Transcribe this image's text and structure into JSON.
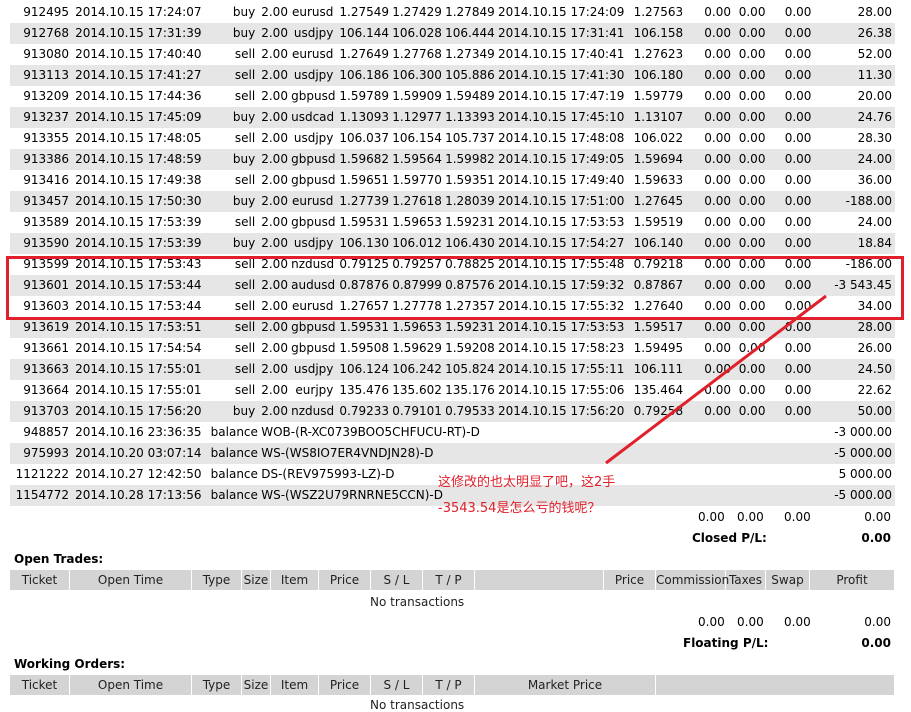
{
  "trades": [
    {
      "ticket": "912495",
      "open_time": "2014.10.15 17:24:07",
      "type": "buy",
      "size": "2.00",
      "item": "eurusd",
      "price": "1.27549",
      "sl": "1.27429",
      "tp": "1.27849",
      "close_time": "2014.10.15 17:24:09",
      "close_price": "1.27563",
      "commission": "0.00",
      "taxes": "0.00",
      "swap": "0.00",
      "profit": "28.00"
    },
    {
      "ticket": "912768",
      "open_time": "2014.10.15 17:31:39",
      "type": "buy",
      "size": "2.00",
      "item": "usdjpy",
      "price": "106.144",
      "sl": "106.028",
      "tp": "106.444",
      "close_time": "2014.10.15 17:31:41",
      "close_price": "106.158",
      "commission": "0.00",
      "taxes": "0.00",
      "swap": "0.00",
      "profit": "26.38"
    },
    {
      "ticket": "913080",
      "open_time": "2014.10.15 17:40:40",
      "type": "sell",
      "size": "2.00",
      "item": "eurusd",
      "price": "1.27649",
      "sl": "1.27768",
      "tp": "1.27349",
      "close_time": "2014.10.15 17:40:41",
      "close_price": "1.27623",
      "commission": "0.00",
      "taxes": "0.00",
      "swap": "0.00",
      "profit": "52.00"
    },
    {
      "ticket": "913113",
      "open_time": "2014.10.15 17:41:27",
      "type": "sell",
      "size": "2.00",
      "item": "usdjpy",
      "price": "106.186",
      "sl": "106.300",
      "tp": "105.886",
      "close_time": "2014.10.15 17:41:30",
      "close_price": "106.180",
      "commission": "0.00",
      "taxes": "0.00",
      "swap": "0.00",
      "profit": "11.30"
    },
    {
      "ticket": "913209",
      "open_time": "2014.10.15 17:44:36",
      "type": "sell",
      "size": "2.00",
      "item": "gbpusd",
      "price": "1.59789",
      "sl": "1.59909",
      "tp": "1.59489",
      "close_time": "2014.10.15 17:47:19",
      "close_price": "1.59779",
      "commission": "0.00",
      "taxes": "0.00",
      "swap": "0.00",
      "profit": "20.00"
    },
    {
      "ticket": "913237",
      "open_time": "2014.10.15 17:45:09",
      "type": "buy",
      "size": "2.00",
      "item": "usdcad",
      "price": "1.13093",
      "sl": "1.12977",
      "tp": "1.13393",
      "close_time": "2014.10.15 17:45:10",
      "close_price": "1.13107",
      "commission": "0.00",
      "taxes": "0.00",
      "swap": "0.00",
      "profit": "24.76"
    },
    {
      "ticket": "913355",
      "open_time": "2014.10.15 17:48:05",
      "type": "sell",
      "size": "2.00",
      "item": "usdjpy",
      "price": "106.037",
      "sl": "106.154",
      "tp": "105.737",
      "close_time": "2014.10.15 17:48:08",
      "close_price": "106.022",
      "commission": "0.00",
      "taxes": "0.00",
      "swap": "0.00",
      "profit": "28.30"
    },
    {
      "ticket": "913386",
      "open_time": "2014.10.15 17:48:59",
      "type": "buy",
      "size": "2.00",
      "item": "gbpusd",
      "price": "1.59682",
      "sl": "1.59564",
      "tp": "1.59982",
      "close_time": "2014.10.15 17:49:05",
      "close_price": "1.59694",
      "commission": "0.00",
      "taxes": "0.00",
      "swap": "0.00",
      "profit": "24.00"
    },
    {
      "ticket": "913416",
      "open_time": "2014.10.15 17:49:38",
      "type": "sell",
      "size": "2.00",
      "item": "gbpusd",
      "price": "1.59651",
      "sl": "1.59770",
      "tp": "1.59351",
      "close_time": "2014.10.15 17:49:40",
      "close_price": "1.59633",
      "commission": "0.00",
      "taxes": "0.00",
      "swap": "0.00",
      "profit": "36.00"
    },
    {
      "ticket": "913457",
      "open_time": "2014.10.15 17:50:30",
      "type": "buy",
      "size": "2.00",
      "item": "eurusd",
      "price": "1.27739",
      "sl": "1.27618",
      "tp": "1.28039",
      "close_time": "2014.10.15 17:51:00",
      "close_price": "1.27645",
      "commission": "0.00",
      "taxes": "0.00",
      "swap": "0.00",
      "profit": "-188.00"
    },
    {
      "ticket": "913589",
      "open_time": "2014.10.15 17:53:39",
      "type": "sell",
      "size": "2.00",
      "item": "gbpusd",
      "price": "1.59531",
      "sl": "1.59653",
      "tp": "1.59231",
      "close_time": "2014.10.15 17:53:53",
      "close_price": "1.59519",
      "commission": "0.00",
      "taxes": "0.00",
      "swap": "0.00",
      "profit": "24.00"
    },
    {
      "ticket": "913590",
      "open_time": "2014.10.15 17:53:39",
      "type": "buy",
      "size": "2.00",
      "item": "usdjpy",
      "price": "106.130",
      "sl": "106.012",
      "tp": "106.430",
      "close_time": "2014.10.15 17:54:27",
      "close_price": "106.140",
      "commission": "0.00",
      "taxes": "0.00",
      "swap": "0.00",
      "profit": "18.84"
    },
    {
      "ticket": "913599",
      "open_time": "2014.10.15 17:53:43",
      "type": "sell",
      "size": "2.00",
      "item": "nzdusd",
      "price": "0.79125",
      "sl": "0.79257",
      "tp": "0.78825",
      "close_time": "2014.10.15 17:55:48",
      "close_price": "0.79218",
      "commission": "0.00",
      "taxes": "0.00",
      "swap": "0.00",
      "profit": "-186.00"
    },
    {
      "ticket": "913601",
      "open_time": "2014.10.15 17:53:44",
      "type": "sell",
      "size": "2.00",
      "item": "audusd",
      "price": "0.87876",
      "sl": "0.87999",
      "tp": "0.87576",
      "close_time": "2014.10.15 17:59:32",
      "close_price": "0.87867",
      "commission": "0.00",
      "taxes": "0.00",
      "swap": "0.00",
      "profit": "-3 543.45"
    },
    {
      "ticket": "913603",
      "open_time": "2014.10.15 17:53:44",
      "type": "sell",
      "size": "2.00",
      "item": "eurusd",
      "price": "1.27657",
      "sl": "1.27778",
      "tp": "1.27357",
      "close_time": "2014.10.15 17:55:32",
      "close_price": "1.27640",
      "commission": "0.00",
      "taxes": "0.00",
      "swap": "0.00",
      "profit": "34.00"
    },
    {
      "ticket": "913619",
      "open_time": "2014.10.15 17:53:51",
      "type": "sell",
      "size": "2.00",
      "item": "gbpusd",
      "price": "1.59531",
      "sl": "1.59653",
      "tp": "1.59231",
      "close_time": "2014.10.15 17:53:53",
      "close_price": "1.59517",
      "commission": "0.00",
      "taxes": "0.00",
      "swap": "0.00",
      "profit": "28.00"
    },
    {
      "ticket": "913661",
      "open_time": "2014.10.15 17:54:54",
      "type": "sell",
      "size": "2.00",
      "item": "gbpusd",
      "price": "1.59508",
      "sl": "1.59629",
      "tp": "1.59208",
      "close_time": "2014.10.15 17:58:23",
      "close_price": "1.59495",
      "commission": "0.00",
      "taxes": "0.00",
      "swap": "0.00",
      "profit": "26.00"
    },
    {
      "ticket": "913663",
      "open_time": "2014.10.15 17:55:01",
      "type": "sell",
      "size": "2.00",
      "item": "usdjpy",
      "price": "106.124",
      "sl": "106.242",
      "tp": "105.824",
      "close_time": "2014.10.15 17:55:11",
      "close_price": "106.111",
      "commission": "0.00",
      "taxes": "0.00",
      "swap": "0.00",
      "profit": "24.50"
    },
    {
      "ticket": "913664",
      "open_time": "2014.10.15 17:55:01",
      "type": "sell",
      "size": "2.00",
      "item": "eurjpy",
      "price": "135.476",
      "sl": "135.602",
      "tp": "135.176",
      "close_time": "2014.10.15 17:55:06",
      "close_price": "135.464",
      "commission": "0.00",
      "taxes": "0.00",
      "swap": "0.00",
      "profit": "22.62"
    },
    {
      "ticket": "913703",
      "open_time": "2014.10.15 17:56:20",
      "type": "buy",
      "size": "2.00",
      "item": "nzdusd",
      "price": "0.79233",
      "sl": "0.79101",
      "tp": "0.79533",
      "close_time": "2014.10.15 17:56:20",
      "close_price": "0.79258",
      "commission": "0.00",
      "taxes": "0.00",
      "swap": "0.00",
      "profit": "50.00"
    }
  ],
  "balances": [
    {
      "ticket": "948857",
      "time": "2014.10.16 23:36:35",
      "type": "balance",
      "comment": "WOB-(R-XC0739BOO5CHFUCU-RT)-D",
      "profit": "-3 000.00"
    },
    {
      "ticket": "975993",
      "time": "2014.10.20 03:07:14",
      "type": "balance",
      "comment": "WS-(WS8IO7ER4VNDJN28)-D",
      "profit": "-5 000.00"
    },
    {
      "ticket": "1121222",
      "time": "2014.10.27 12:42:50",
      "type": "balance",
      "comment": "DS-(REV975993-LZ)-D",
      "profit": "5 000.00"
    },
    {
      "ticket": "1154772",
      "time": "2014.10.28 17:13:56",
      "type": "balance",
      "comment": "WS-(WSZ2U79RNRNE5CCN)-D",
      "profit": "-5 000.00"
    }
  ],
  "closed_summary": {
    "commission": "0.00",
    "taxes": "0.00",
    "swap": "0.00",
    "profit": "0.00",
    "label": "Closed P/L:",
    "total": "0.00"
  },
  "open_trades": {
    "title": "Open Trades:",
    "headers": [
      "Ticket",
      "Open Time",
      "Type",
      "Size",
      "Item",
      "Price",
      "S / L",
      "T / P",
      "",
      "Price",
      "Commission",
      "Taxes",
      "Swap",
      "Profit"
    ],
    "empty": "No transactions",
    "summary": {
      "commission": "0.00",
      "taxes": "0.00",
      "swap": "0.00",
      "profit": "0.00",
      "label": "Floating P/L:",
      "total": "0.00"
    }
  },
  "working_orders": {
    "title": "Working Orders:",
    "headers": [
      "Ticket",
      "Open Time",
      "Type",
      "Size",
      "Item",
      "Price",
      "S / L",
      "T / P",
      "Market Price",
      ""
    ],
    "empty": "No transactions"
  },
  "annotation": {
    "line1": "这修改的也太明显了吧，这2手",
    "line2": "-3543.54是怎么亏的钱呢？",
    "color": "#e0202a"
  },
  "colors": {
    "row_shade": "#e6e6e6",
    "header_bg": "#d4d4d4",
    "highlight": "#e0202a"
  }
}
